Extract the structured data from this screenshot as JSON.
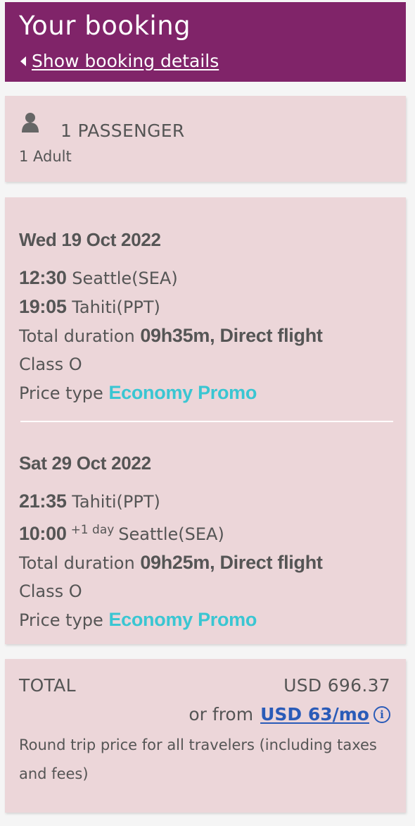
{
  "header": {
    "title": "Your booking",
    "details_link": "Show booking details",
    "background_color": "#802469"
  },
  "passengers": {
    "icon": "person-icon",
    "count_label": "1 PASSENGER",
    "type_label": "1 Adult"
  },
  "segments": [
    {
      "date": "Wed 19 Oct 2022",
      "depart_time": "12:30",
      "depart_city": "Seattle(SEA)",
      "arrive_time": "19:05",
      "arrive_extra": "",
      "arrive_city": "Tahiti(PPT)",
      "duration_label": "Total duration",
      "duration_value": "09h35m, Direct flight",
      "class_label": "Class O",
      "price_type_label": "Price type",
      "price_type_value": "Economy Promo"
    },
    {
      "date": "Sat 29 Oct 2022",
      "depart_time": "21:35",
      "depart_city": "Tahiti(PPT)",
      "arrive_time": "10:00",
      "arrive_extra": "+1 day",
      "arrive_city": "Seattle(SEA)",
      "duration_label": "Total duration",
      "duration_value": "09h25m, Direct flight",
      "class_label": "Class O",
      "price_type_label": "Price type",
      "price_type_value": "Economy Promo"
    }
  ],
  "total": {
    "label": "TOTAL",
    "amount": "USD 696.37",
    "financing_prefix": "or from",
    "financing_link": "USD 63/mo",
    "info_icon": "info-icon",
    "note": "Round trip price for all travelers (including taxes and fees)"
  },
  "colors": {
    "card_background": "#ecd6d9",
    "promo_accent": "#3ac6d2",
    "link": "#2a5bb8"
  }
}
